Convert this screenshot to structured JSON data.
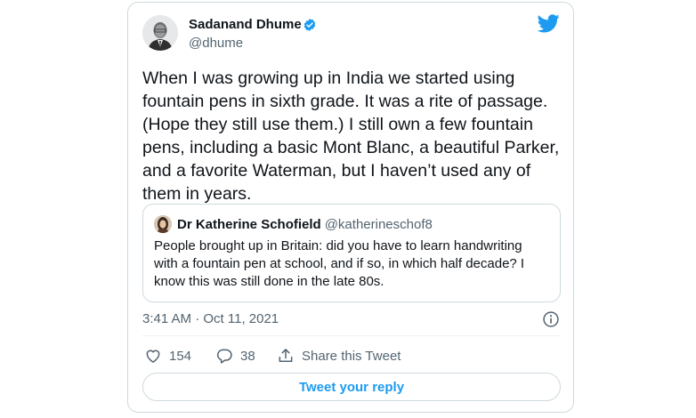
{
  "author": {
    "display_name": "Sadanand Dhume",
    "handle": "@dhume",
    "verified": true
  },
  "tweet": {
    "text": "When I was growing up in India we started using fountain pens in sixth grade. It was a rite of passage. (Hope they still use them.) I still own a few fountain pens, including a basic Mont Blanc, a beautiful Parker, and a favorite Waterman, but I haven’t used any of them in years.",
    "timestamp": "3:41 AM · Oct 11, 2021"
  },
  "quoted_tweet": {
    "display_name": "Dr Katherine Schofield",
    "handle": "@katherineschof8",
    "text": "People brought up in Britain: did you have to learn handwriting with a fountain pen at school, and if so, in which half decade? I know this was still done in the late 80s."
  },
  "actions": {
    "likes": "154",
    "replies": "38",
    "share_label": "Share this Tweet",
    "reply_cta": "Tweet your reply"
  },
  "colors": {
    "accent": "#1d9bf0",
    "secondary_text": "#536471",
    "border": "#cfd9de"
  },
  "icons": {
    "logo": "twitter-bird-icon",
    "verified": "verified-badge-icon",
    "info": "info-icon",
    "like": "heart-icon",
    "reply": "reply-bubble-icon",
    "share": "share-icon"
  }
}
